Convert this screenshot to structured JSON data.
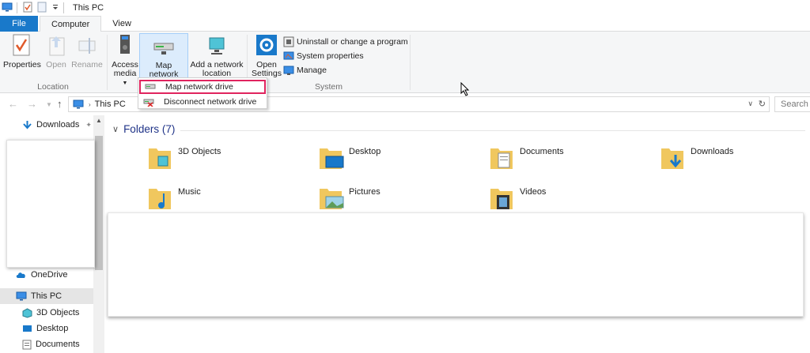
{
  "window": {
    "title": "This PC"
  },
  "tabs": [
    {
      "label": "File"
    },
    {
      "label": "Computer"
    },
    {
      "label": "View"
    }
  ],
  "ribbon": {
    "location": {
      "label": "Location",
      "properties": "Properties",
      "open": "Open",
      "rename": "Rename"
    },
    "network": {
      "access_media_line1": "Access",
      "access_media_line2": "media",
      "map_drive_line1": "Map network",
      "map_drive_line2": "drive",
      "add_location_line1": "Add a network",
      "add_location_line2": "location"
    },
    "system": {
      "label": "System",
      "open_settings_line1": "Open",
      "open_settings_line2": "Settings",
      "uninstall": "Uninstall or change a program",
      "system_properties": "System properties",
      "manage": "Manage"
    }
  },
  "dropdown": {
    "items": [
      {
        "label": "Map network drive"
      },
      {
        "label": "Disconnect network drive"
      }
    ]
  },
  "address": {
    "crumb": "This PC",
    "search_placeholder": "Search This PC"
  },
  "navpane": {
    "items": [
      {
        "label": "Downloads"
      },
      {
        "label": "OneDrive"
      },
      {
        "label": "This PC"
      },
      {
        "label": "3D Objects"
      },
      {
        "label": "Desktop"
      },
      {
        "label": "Documents"
      }
    ]
  },
  "content": {
    "section_title": "Folders (7)",
    "folders": [
      {
        "label": "3D Objects"
      },
      {
        "label": "Desktop"
      },
      {
        "label": "Documents"
      },
      {
        "label": "Downloads"
      },
      {
        "label": "Music"
      },
      {
        "label": "Pictures"
      },
      {
        "label": "Videos"
      }
    ]
  },
  "colors": {
    "accent": "#1979ca",
    "highlight_border": "#e0245e",
    "folder": "#f0c75e"
  }
}
